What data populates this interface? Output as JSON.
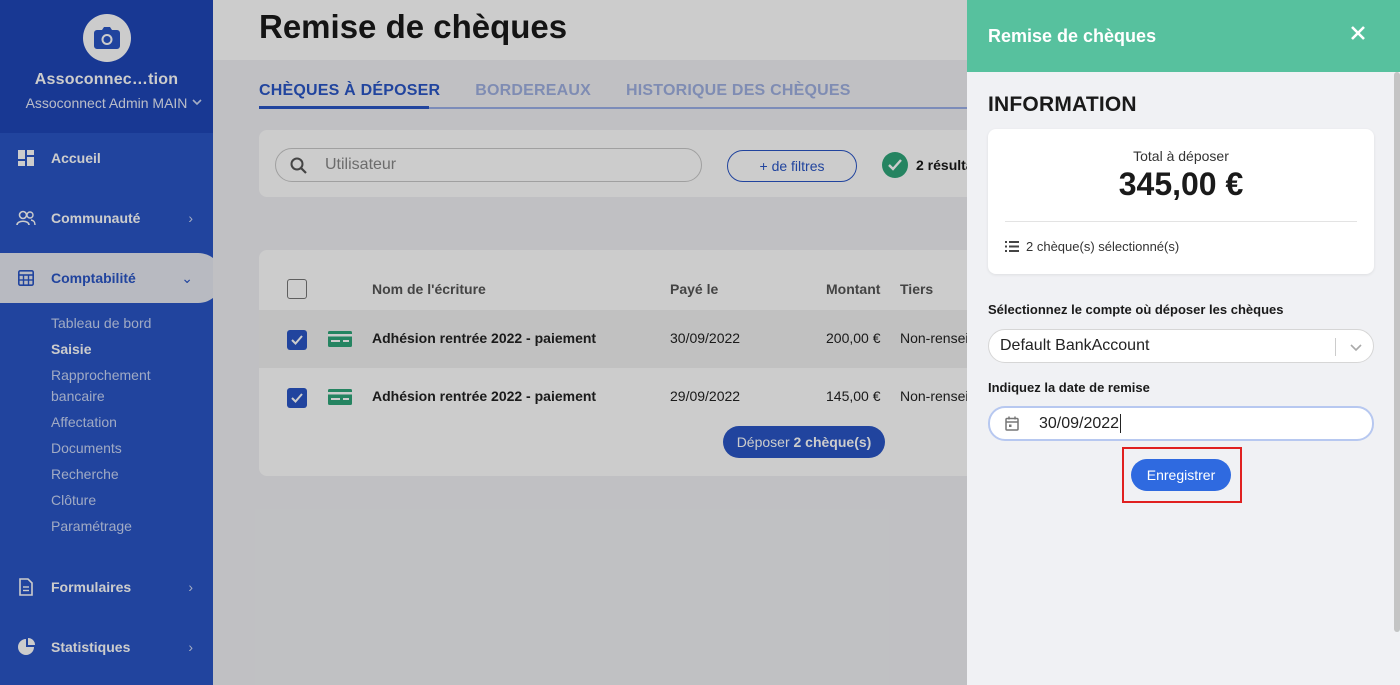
{
  "sidebar": {
    "org_name": "Assoconnec…tion",
    "org_sub": "Assoconnect Admin MAIN",
    "nav": [
      {
        "label": "Accueil",
        "icon": "dashboard-icon"
      },
      {
        "label": "Communauté",
        "icon": "community-icon"
      },
      {
        "label": "Comptabilité",
        "icon": "accounting-icon"
      },
      {
        "label": "Formulaires",
        "icon": "forms-icon"
      },
      {
        "label": "Statistiques",
        "icon": "stats-icon"
      }
    ],
    "subnav": [
      "Tableau de bord",
      "Saisie",
      "Rapprochement",
      "bancaire",
      "Affectation",
      "Documents",
      "Recherche",
      "Clôture",
      "Paramétrage"
    ]
  },
  "main": {
    "title": "Remise de chèques",
    "tabs": [
      "CHÈQUES À DÉPOSER",
      "BORDEREAUX",
      "HISTORIQUE DES CHÈQUES"
    ],
    "search_placeholder": "Utilisateur",
    "filters_label": "+ de filtres",
    "results_label": "2 résulta",
    "columns": [
      "Nom de l'écriture",
      "Payé le",
      "Montant",
      "Tiers"
    ],
    "rows": [
      {
        "name": "Adhésion rentrée 2022 - paiement",
        "date": "30/09/2022",
        "amount": "200,00 €",
        "tiers": "Non-rensei",
        "checked": true
      },
      {
        "name": "Adhésion rentrée 2022 - paiement",
        "date": "29/09/2022",
        "amount": "145,00 €",
        "tiers": "Non-rensei",
        "checked": true
      }
    ],
    "deposit_prefix": "Déposer ",
    "deposit_bold": "2 chèque(s)"
  },
  "drawer": {
    "title": "Remise de chèques",
    "section_title": "INFORMATION",
    "total_label": "Total à déposer",
    "total_amount": "345,00 €",
    "selected_count": "2 chèque(s) sélectionné(s)",
    "account_label": "Sélectionnez le compte où déposer les chèques",
    "account_value": "Default BankAccount",
    "date_label": "Indiquez la date de remise",
    "date_value": "30/09/2022",
    "save_label": "Enregistrer"
  },
  "colors": {
    "sidebar": "#2a56c6",
    "drawer_header": "#57c19e",
    "primary": "#2a56c6",
    "highlight": "#e02020"
  }
}
